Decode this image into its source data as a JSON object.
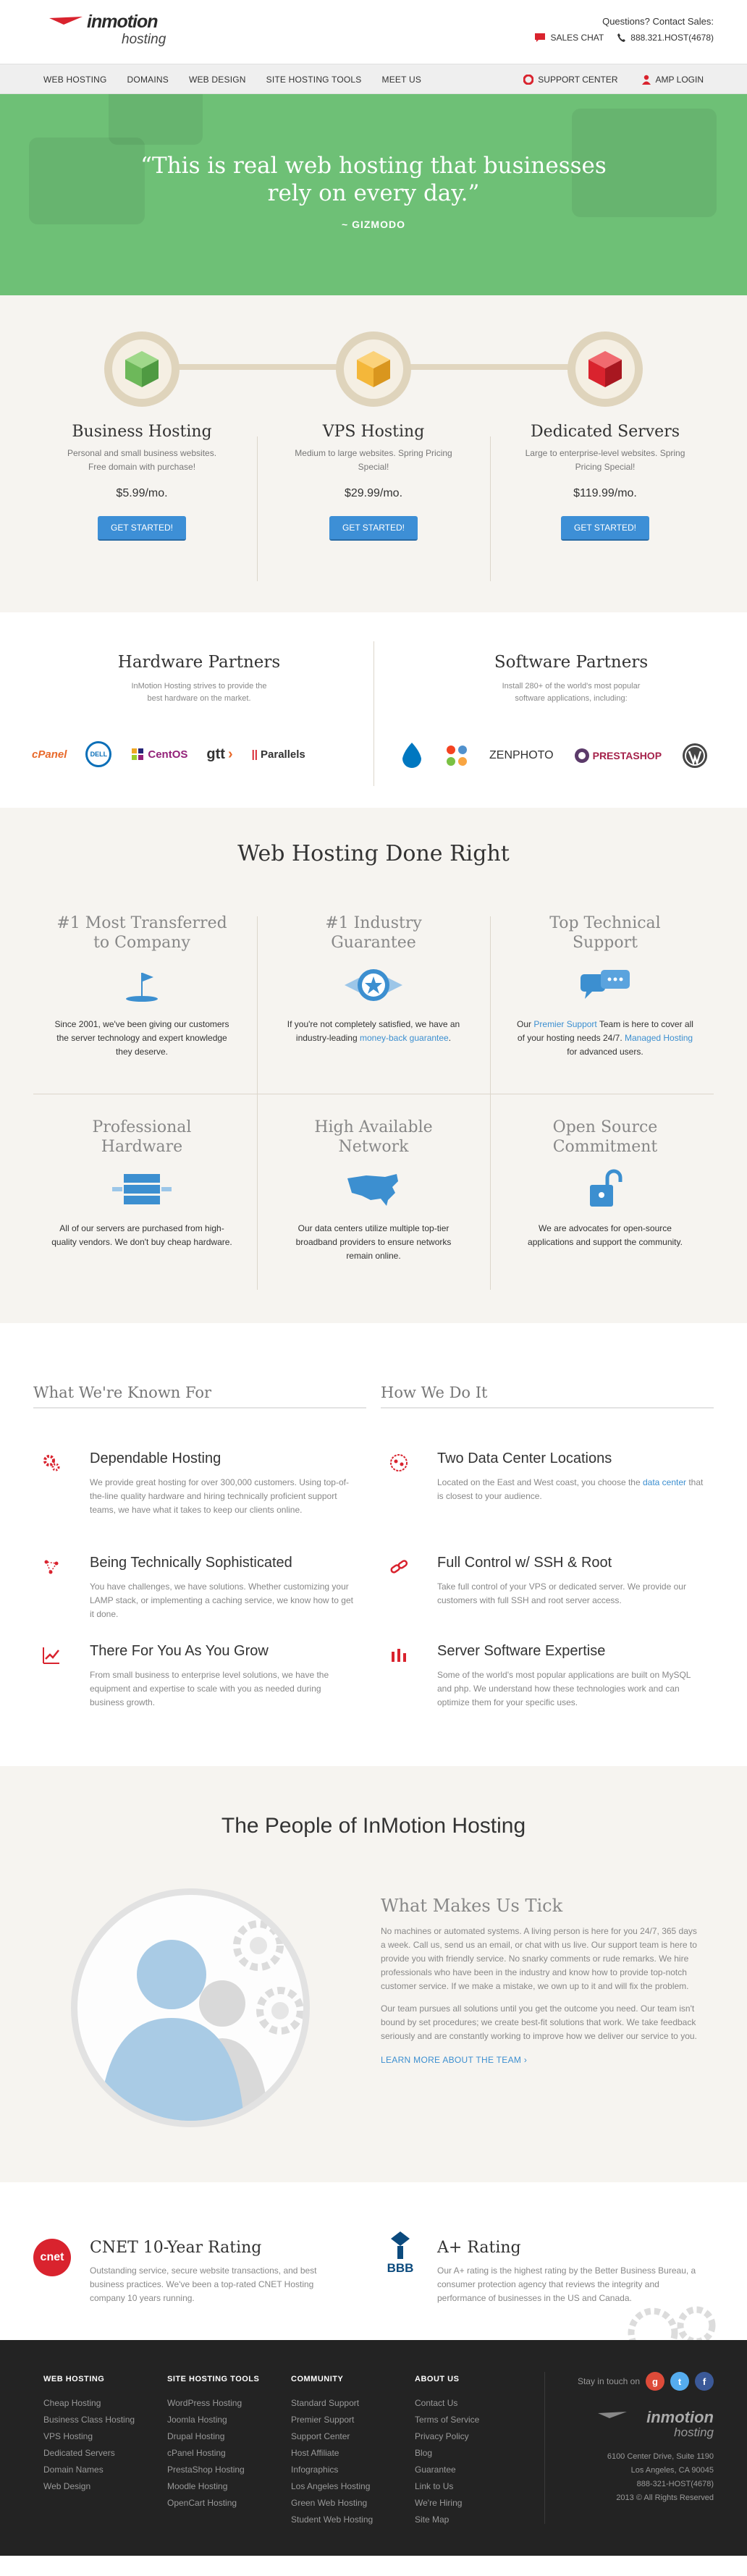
{
  "header": {
    "brand": "inmotion",
    "brand_sub": "hosting",
    "contact_title": "Questions? Contact Sales:",
    "sales_chat": "SALES CHAT",
    "phone": "888.321.HOST(4678)"
  },
  "nav": {
    "items": [
      "WEB HOSTING",
      "DOMAINS",
      "WEB DESIGN",
      "SITE HOSTING TOOLS",
      "MEET US"
    ],
    "support": "SUPPORT CENTER",
    "amp": "AMP LOGIN"
  },
  "hero": {
    "quote_line1": "“This is real web hosting that businesses",
    "quote_line2": "rely on every day.”",
    "byline": "~ GIZMODO"
  },
  "products": [
    {
      "title": "Business Hosting",
      "desc": "Personal and small business websites. Free domain with purchase!",
      "price": "$5.99/mo.",
      "cta": "GET STARTED!",
      "color": "#7ac36a"
    },
    {
      "title": "VPS Hosting",
      "desc": "Medium to large websites. Spring Pricing Special!",
      "price": "$29.99/mo.",
      "cta": "GET STARTED!",
      "color": "#f4b73a"
    },
    {
      "title": "Dedicated Servers",
      "desc": "Large to enterprise-level websites. Spring Pricing Special!",
      "price": "$119.99/mo.",
      "cta": "GET STARTED!",
      "color": "#d9232e"
    }
  ],
  "partners": {
    "hardware_title": "Hardware Partners",
    "hardware_desc": "InMotion Hosting strives to provide the best hardware on the market.",
    "software_title": "Software Partners",
    "software_desc": "Install 280+ of the world's most popular software applications, including:",
    "hardware_logos": [
      "cPanel",
      "DELL",
      "CentOS",
      "gtt",
      "Parallels"
    ],
    "software_logos": [
      "ZENPHOTO",
      "PRESTASHOP"
    ]
  },
  "done": {
    "title": "Web Hosting Done Right",
    "features": [
      {
        "title1": "#1 Most Transferred",
        "title2": "to Company",
        "text": "Since 2001, we've been giving our customers the server technology and expert knowledge they deserve."
      },
      {
        "title1": "#1 Industry",
        "title2": "Guarantee",
        "text_a": "If you're not completely satisfied, we have an industry-leading ",
        "link": "money-back guarantee",
        "text_b": "."
      },
      {
        "title1": "Top Technical",
        "title2": "Support",
        "text_a": "Our ",
        "link": "Premier Support",
        "text_b": " Team is here to cover all of your hosting needs 24/7. ",
        "link2": "Managed Hosting",
        "text_c": " for advanced users."
      },
      {
        "title1": "Professional",
        "title2": "Hardware",
        "text": "All of our servers are purchased from high-quality vendors. We don't buy cheap hardware."
      },
      {
        "title1": "High Available",
        "title2": "Network",
        "text": "Our data centers utilize multiple top-tier broadband providers to ensure networks remain online."
      },
      {
        "title1": "Open Source",
        "title2": "Commitment",
        "text": "We are advocates for open-source applications and support the community."
      }
    ]
  },
  "known": {
    "left_title": "What We're Known For",
    "right_title": "How We Do It",
    "left": [
      {
        "title": "Dependable Hosting",
        "text": "We provide great hosting for over 300,000 customers. Using top-of-the-line quality hardware and hiring technically proficient support teams, we have what it takes to keep our clients online."
      },
      {
        "title": "Being Technically Sophisticated",
        "text": "You have challenges, we have solutions. Whether customizing your LAMP stack, or implementing a caching service, we know how to get it done."
      },
      {
        "title": "There For You As You Grow",
        "text": "From small business to enterprise level solutions, we have the equipment and expertise to scale with you as needed during business growth."
      }
    ],
    "right": [
      {
        "title": "Two Data Center Locations",
        "text_a": "Located on the East and West coast, you choose the ",
        "link": "data center",
        "text_b": " that is closest to your audience."
      },
      {
        "title": "Full Control w/ SSH & Root",
        "text": "Take full control of your VPS or dedicated server. We provide our customers with full SSH and root server access."
      },
      {
        "title": "Server Software Expertise",
        "text": "Some of the world's most popular applications are built on MySQL and php. We understand how these technologies work and can optimize them for your specific uses."
      }
    ]
  },
  "people": {
    "title": "The People of InMotion Hosting",
    "sub": "What Makes Us Tick",
    "p1": "No machines or automated systems. A living person is here for you 24/7, 365 days a week. Call us, send us an email, or chat with us live. Our support team is here to provide you with friendly service. No snarky comments or rude remarks. We hire professionals who have been in the industry and know how to provide top-notch customer service. If we make a mistake, we own up to it and will fix the problem.",
    "p2": "Our team pursues all solutions until you get the outcome you need. Our team isn't bound by set procedures; we create best-fit solutions that work. We take feedback seriously and are constantly working to improve how we deliver our service to you.",
    "more": "LEARN MORE ABOUT THE TEAM"
  },
  "ratings": [
    {
      "badge": "cnet",
      "title": "CNET 10-Year Rating",
      "text": "Outstanding service, secure website transactions, and best business practices. We've been a top-rated CNET Hosting company 10 years running."
    },
    {
      "badge": "BBB",
      "title": "A+ Rating",
      "text": "Our A+ rating is the highest rating by the Better Business Bureau, a consumer protection agency that reviews the integrity and performance of businesses in the US and Canada."
    }
  ],
  "footer": {
    "cols": [
      {
        "title": "WEB HOSTING",
        "items": [
          "Cheap Hosting",
          "Business Class Hosting",
          "VPS Hosting",
          "Dedicated Servers",
          "Domain Names",
          "Web Design"
        ]
      },
      {
        "title": "SITE HOSTING TOOLS",
        "items": [
          "WordPress Hosting",
          "Joomla Hosting",
          "Drupal Hosting",
          "cPanel Hosting",
          "PrestaShop Hosting",
          "Moodle Hosting",
          "OpenCart Hosting"
        ]
      },
      {
        "title": "COMMUNITY",
        "items": [
          "Standard Support",
          "Premier Support",
          "Support Center",
          "Host Affiliate",
          "Infographics",
          "Los Angeles Hosting",
          "Green Web Hosting",
          "Student Web Hosting"
        ]
      },
      {
        "title": "ABOUT US",
        "items": [
          "Contact Us",
          "Terms of Service",
          "Privacy Policy",
          "Blog",
          "Guarantee",
          "Link to Us",
          "We're Hiring",
          "Site Map"
        ]
      }
    ],
    "touch": "Stay in touch on",
    "brand": "inmotion",
    "brand_sub": "hosting",
    "addr1": "6100 Center Drive, Suite 1190",
    "addr2": "Los Angeles, CA 90045",
    "addr3": "888-321-HOST(4678)",
    "addr4": "2013 © All Rights Reserved"
  }
}
